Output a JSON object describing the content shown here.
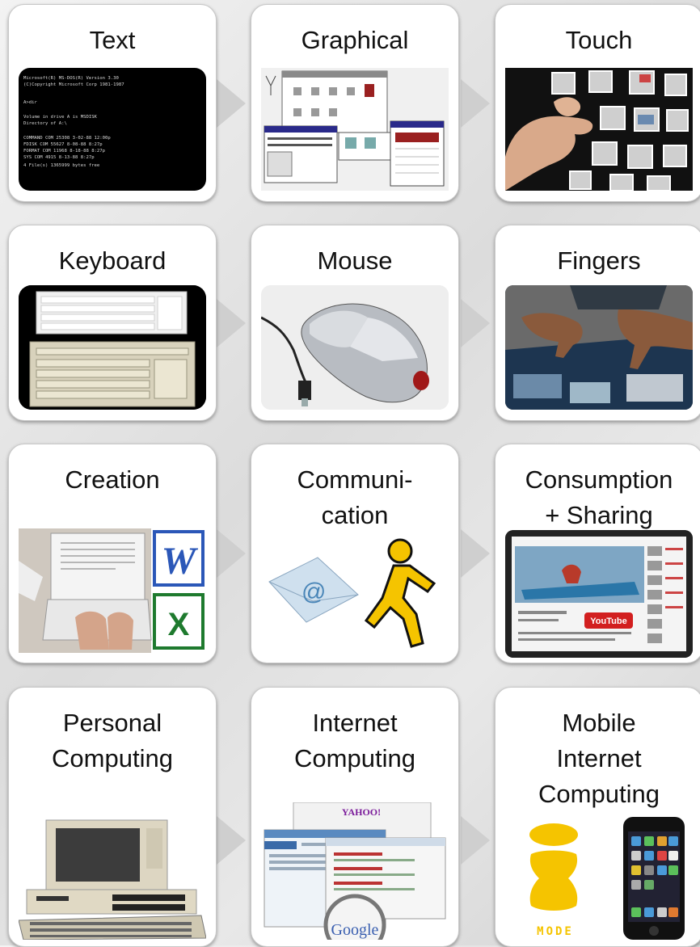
{
  "rows": [
    {
      "cards": [
        {
          "title": "Text"
        },
        {
          "title": "Graphical"
        },
        {
          "title": "Touch"
        }
      ]
    },
    {
      "cards": [
        {
          "title": "Keyboard"
        },
        {
          "title": "Mouse"
        },
        {
          "title": "Fingers"
        }
      ]
    },
    {
      "cards": [
        {
          "title": "Creation"
        },
        {
          "title": "Communi-\ncation"
        },
        {
          "title": "Consumption\n+ Sharing"
        }
      ]
    },
    {
      "cards": [
        {
          "title": "Personal\nComputing"
        },
        {
          "title": "Internet\nComputing"
        },
        {
          "title": "Mobile\nInternet\nComputing"
        }
      ]
    }
  ],
  "images": {
    "dos_screen_lines": [
      "Microsoft(R) MS-DOS(R)  Version 3.30",
      "   (C)Copyright Microsoft Corp 1981-1987",
      "A>dir",
      "Volume in drive A is MSDISK",
      "Directory of  A:\\",
      "COMMAND  COM   25308  3-02-88  12:00p",
      "FDISK    COM   55627  8-08-88   8:27p",
      "FORMAT   COM   11968  8-18-88   8:27p",
      "SYS      COM    4915  8-13-88   8:27p",
      "     4 File(s)   1365999 bytes free"
    ],
    "word_letter": "W",
    "excel_letter": "X",
    "email_symbol": "@",
    "youtube_label": "YouTube",
    "google_label": "Google",
    "yahoo_label": "YAHOO!",
    "imode_label": "MODE"
  },
  "colors": {
    "arrow": "#cfcfcf",
    "card_bg": "#ffffff",
    "title_text": "#111111",
    "word_blue": "#2b57b8",
    "excel_green": "#1e7a2e",
    "aim_yellow": "#f5c400",
    "youtube_red": "#d21f1f"
  }
}
